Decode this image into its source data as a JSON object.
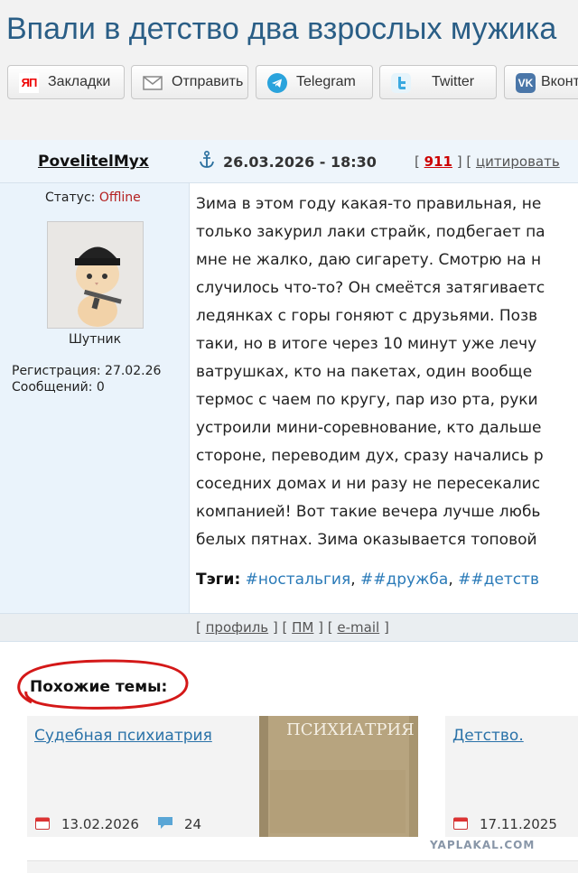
{
  "page": {
    "title": "Впали в детство два взрослых мужика"
  },
  "share": {
    "buttons": [
      {
        "label": "Закладки",
        "icon": "yandex-bookmarks-icon",
        "icon_text": "ЯП"
      },
      {
        "label": "Отправить",
        "icon": "envelope-icon"
      },
      {
        "label": "Telegram",
        "icon": "telegram-icon"
      },
      {
        "label": "Twitter",
        "icon": "twitter-icon"
      },
      {
        "label": "Вконт",
        "icon": "vk-icon",
        "icon_text": "VK"
      }
    ]
  },
  "author": {
    "name": "PovelitelMyx",
    "status_label": "Статус:",
    "status_value": "Offline",
    "rank": "Шутник",
    "registration": "Регистрация: 27.02.26",
    "messages": "Сообщений: 0"
  },
  "post": {
    "date": "26.03.2026 - 18:30",
    "number": "911",
    "quote_label": "цитировать",
    "lines": [
      "Зима в этом году какая-то правильная, не",
      "только закурил лаки страйк, подбегает па",
      "мне не жалко, даю сигарету. Смотрю на н",
      "случилось что-то? Он смеётся затягиваетс",
      "ледянках с горы гоняют с друзьями. Позв",
      "таки, но в итоге через 10 минут уже лечу",
      "ватрушках, кто на пакетах, один вообще",
      "термос с чаем по кругу, пар изо рта, руки",
      "устроили мини-соревнование, кто дальше",
      "стороне, переводим дух, сразу начались р",
      "соседних домах и ни разу не пересекалис",
      "компанией! Вот такие вечера лучше любь",
      "белых пятнах. Зима оказывается топовой"
    ],
    "tags_label": "Тэги:",
    "tags": [
      "#ностальгия",
      "##дружба",
      "##детств"
    ],
    "footer_links": [
      "профиль",
      "ПМ",
      "e-mail"
    ]
  },
  "similar": {
    "heading": "Похожие темы:",
    "cards": [
      {
        "title": "Судебная психиатрия",
        "date": "13.02.2026",
        "comments": "24",
        "image_text": "ПСИХИАТРИЯ"
      },
      {
        "title": "Детство.",
        "date": "17.11.2025"
      }
    ]
  },
  "watermark": "YAPLAKAL.COM",
  "colors": {
    "title": "#2a5e86",
    "link": "#2a72a8",
    "offline": "#b42020",
    "post_number": "#cc0000",
    "author_bg": "#eaf3fb"
  }
}
